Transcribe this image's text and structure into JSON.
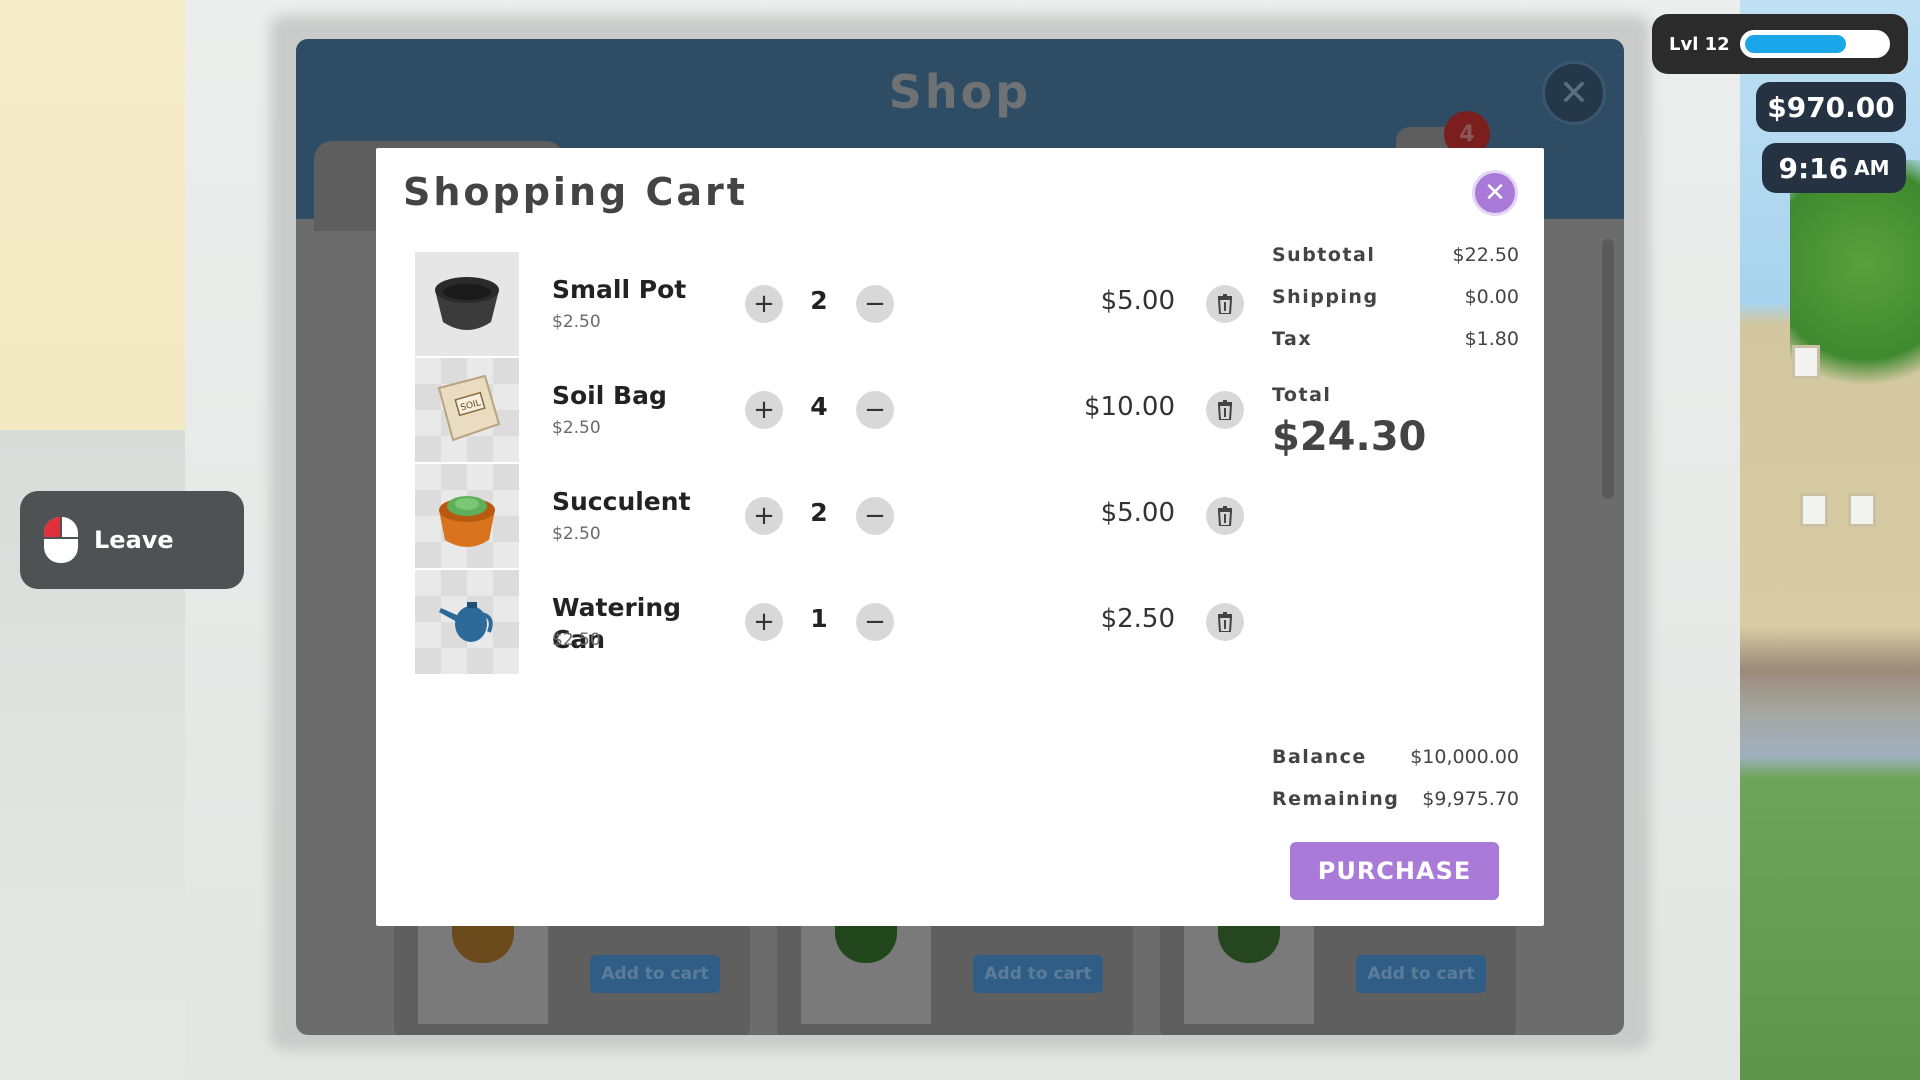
{
  "hud": {
    "level_label": "Lvl 12",
    "xp_progress": 0.72,
    "money": "$970.00",
    "time": "9:16",
    "ampm": "AM"
  },
  "leave": {
    "label": "Leave",
    "icon": "mouse-left-click-icon"
  },
  "shop": {
    "title": "Shop",
    "cart_badge_count": "4",
    "product_cards": [
      {
        "add_label": "Add to cart"
      },
      {
        "add_label": "Add to cart"
      },
      {
        "add_label": "Add to cart"
      }
    ]
  },
  "cart": {
    "title": "Shopping Cart",
    "items": [
      {
        "name": "Small Pot",
        "unit_price": "$2.50",
        "qty": "2",
        "line_total": "$5.00",
        "icon": "black-pot-icon"
      },
      {
        "name": "Soil Bag",
        "unit_price": "$2.50",
        "qty": "4",
        "line_total": "$10.00",
        "icon": "soil-bag-icon"
      },
      {
        "name": "Succulent",
        "unit_price": "$2.50",
        "qty": "2",
        "line_total": "$5.00",
        "icon": "succulent-icon"
      },
      {
        "name": "Watering Can",
        "unit_price": "$2.50",
        "qty": "1",
        "line_total": "$2.50",
        "icon": "watering-can-icon"
      }
    ],
    "summary": {
      "subtotal_label": "Subtotal",
      "subtotal": "$22.50",
      "shipping_label": "Shipping",
      "shipping": "$0.00",
      "tax_label": "Tax",
      "tax": "$1.80",
      "total_label": "Total",
      "total": "$24.30",
      "balance_label": "Balance",
      "balance": "$10,000.00",
      "remaining_label": "Remaining",
      "remaining": "$9,975.70"
    },
    "purchase_label": "PURCHASE",
    "colors": {
      "accent": "#a97ad8"
    }
  }
}
